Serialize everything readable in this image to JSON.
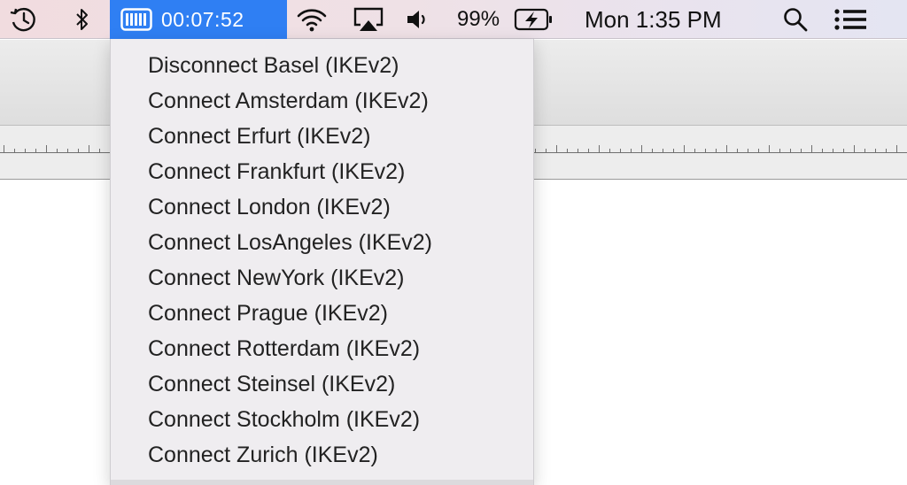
{
  "menubar": {
    "vpn": {
      "timer": "00:07:52",
      "icon": "vpn-status-icon"
    },
    "battery": {
      "percent": "99%",
      "icon": "battery-charging-icon"
    },
    "clock": "Mon 1:35 PM",
    "icons": [
      "time-machine-icon",
      "bluetooth-icon",
      "wifi-icon",
      "airplay-icon",
      "volume-icon",
      "spotlight-search-icon",
      "notification-center-icon"
    ]
  },
  "vpn_menu": {
    "items": [
      {
        "label": "Disconnect Basel (IKEv2)"
      },
      {
        "label": "Connect Amsterdam (IKEv2)"
      },
      {
        "label": "Connect Erfurt (IKEv2)"
      },
      {
        "label": "Connect Frankfurt (IKEv2)"
      },
      {
        "label": "Connect London (IKEv2)"
      },
      {
        "label": "Connect LosAngeles (IKEv2)"
      },
      {
        "label": "Connect NewYork (IKEv2)"
      },
      {
        "label": "Connect Prague (IKEv2)"
      },
      {
        "label": "Connect Rotterdam (IKEv2)"
      },
      {
        "label": "Connect Steinsel (IKEv2)"
      },
      {
        "label": "Connect Stockholm (IKEv2)"
      },
      {
        "label": "Connect Zurich (IKEv2)"
      }
    ]
  },
  "colors": {
    "vpn_highlight": "#2f7ff3",
    "menu_background": "#efedf0"
  }
}
